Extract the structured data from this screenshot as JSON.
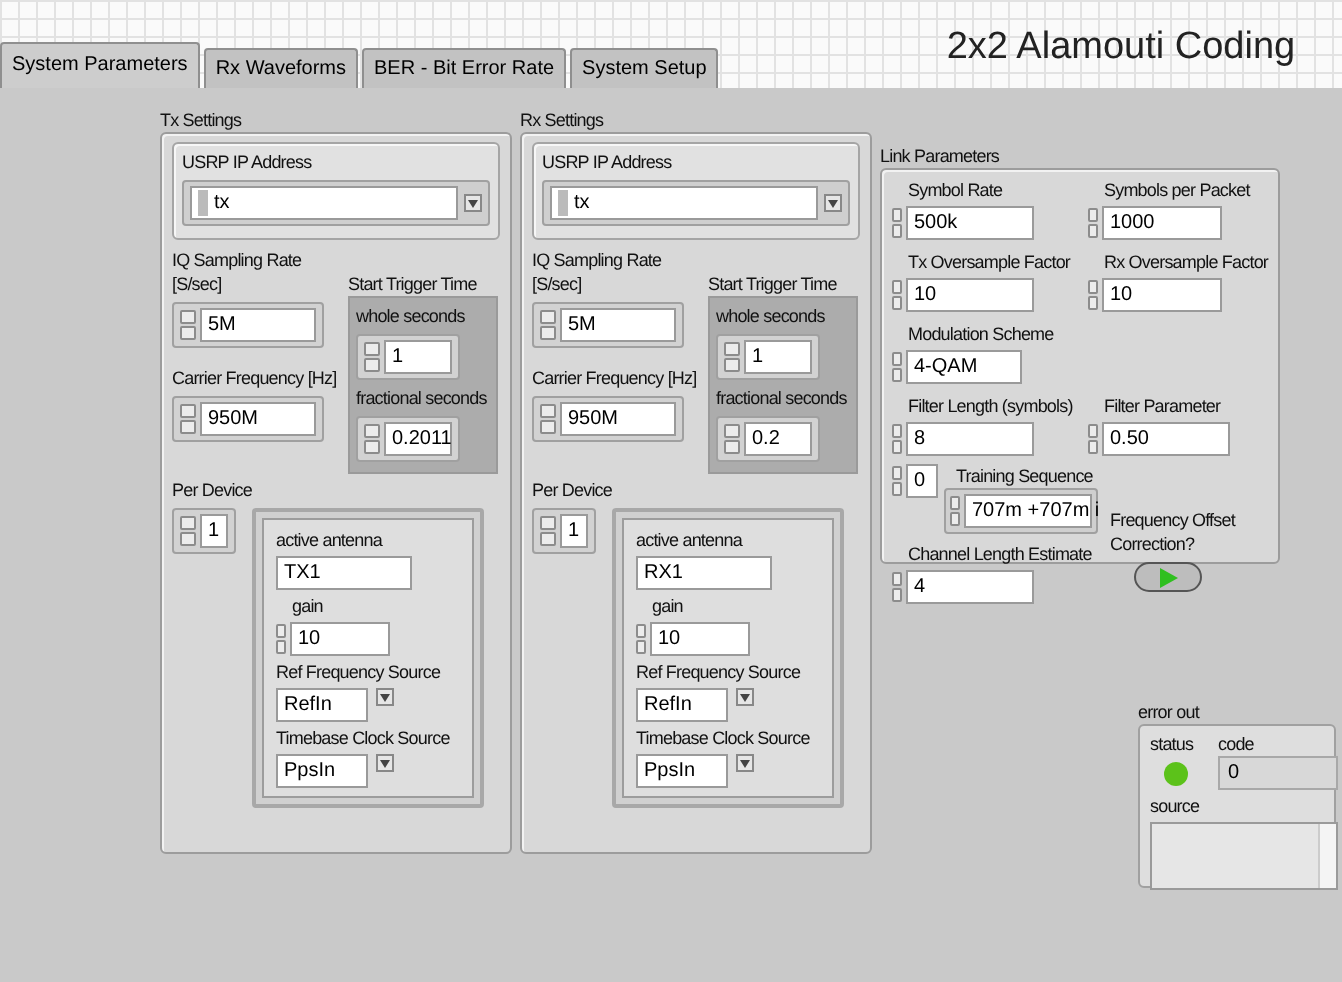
{
  "title": "2x2 Alamouti Coding",
  "tabs": [
    {
      "label": "System Parameters",
      "selected": true
    },
    {
      "label": "Rx Waveforms",
      "selected": false
    },
    {
      "label": "BER - Bit Error Rate",
      "selected": false
    },
    {
      "label": "System Setup",
      "selected": false
    }
  ],
  "device_panels": [
    {
      "label": "Tx Settings",
      "ip": {
        "label": "USRP IP Address",
        "value": "tx"
      },
      "rate": {
        "label": "IQ Sampling Rate [S/sec]",
        "value": "5M"
      },
      "carrier": {
        "label": "Carrier Frequency [Hz]",
        "value": "950M"
      },
      "trigger_label": "Start Trigger Time",
      "whole": {
        "label": "whole seconds",
        "value": "1"
      },
      "fractional": {
        "label": "fractional seconds",
        "value": "0.2011"
      },
      "per_device": {
        "label": "Per Device",
        "value": "1"
      },
      "antenna": {
        "label": "active antenna",
        "value": "TX1"
      },
      "gain": {
        "label": "gain",
        "value": "10"
      },
      "ref_source": {
        "label": "Ref Frequency Source",
        "value": "RefIn"
      },
      "clock_source": {
        "label": "Timebase Clock Source",
        "value": "PpsIn"
      }
    },
    {
      "label": "Rx Settings",
      "ip": {
        "label": "USRP IP Address",
        "value": "tx"
      },
      "rate": {
        "label": "IQ Sampling Rate [S/sec]",
        "value": "5M"
      },
      "carrier": {
        "label": "Carrier Frequency [Hz]",
        "value": "950M"
      },
      "trigger_label": "Start Trigger Time",
      "whole": {
        "label": "whole seconds",
        "value": "1"
      },
      "fractional": {
        "label": "fractional seconds",
        "value": "0.2"
      },
      "per_device": {
        "label": "Per Device",
        "value": "1"
      },
      "antenna": {
        "label": "active antenna",
        "value": "RX1"
      },
      "gain": {
        "label": "gain",
        "value": "10"
      },
      "ref_source": {
        "label": "Ref Frequency Source",
        "value": "RefIn"
      },
      "clock_source": {
        "label": "Timebase Clock Source",
        "value": "PpsIn"
      }
    }
  ],
  "link": {
    "label": "Link Parameters",
    "fields": [
      {
        "label": "Symbol Rate",
        "value": "500k"
      },
      {
        "label": "Symbols per Packet",
        "value": "1000"
      },
      {
        "label": "Tx Oversample Factor",
        "value": "10"
      },
      {
        "label": "Rx Oversample Factor",
        "value": "10"
      },
      {
        "label": "Modulation Scheme",
        "value": "4-QAM"
      },
      {
        "label": "Filter Length (symbols)",
        "value": "8"
      },
      {
        "label": "Filter Parameter",
        "value": "0.50"
      }
    ],
    "training": {
      "label": "Training Sequence",
      "index": "0",
      "value": "707m +707m i"
    },
    "channel_length": {
      "label": "Channel Length Estimate",
      "value": "4"
    },
    "freq_offset": {
      "label": "Frequency Offset Correction?",
      "on": true
    }
  },
  "error_out": {
    "label": "error out",
    "status_label": "status",
    "error": false,
    "code_label": "code",
    "code_value": "0",
    "source_label": "source"
  }
}
